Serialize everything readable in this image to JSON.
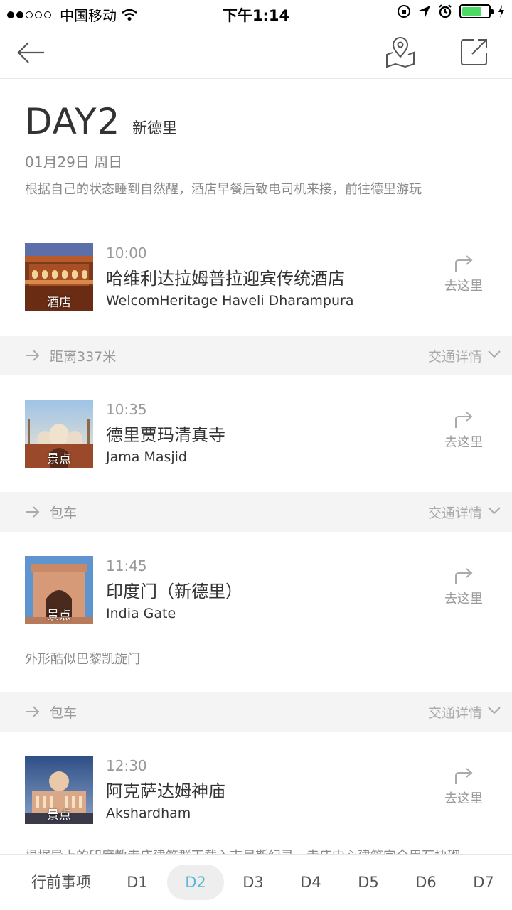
{
  "status": {
    "carrier": "中国移动",
    "time": "下午1:14",
    "battery_level": 0.75
  },
  "nav": {
    "back_icon": "arrow-left-icon",
    "map_icon": "map-pin-icon",
    "share_icon": "share-icon"
  },
  "day": {
    "title": "DAY2",
    "city": "新德里",
    "date": "01月29日 周日",
    "desc": "根据自己的状态睡到自然醒，酒店早餐后致电司机来接，前往德里游玩"
  },
  "go_label": "去这里",
  "pois": [
    {
      "time": "10:00",
      "name": "哈维利达拉姆普拉迎宾传统酒店",
      "en": "WelcomHeritage Haveli Dharampura",
      "tag": "酒店",
      "note": ""
    },
    {
      "time": "10:35",
      "name": "德里贾玛清真寺",
      "en": "Jama Masjid",
      "tag": "景点",
      "note": ""
    },
    {
      "time": "11:45",
      "name": "印度门（新德里）",
      "en": "India Gate",
      "tag": "景点",
      "note": "外形酷似巴黎凯旋门"
    },
    {
      "time": "12:30",
      "name": "阿克萨达姆神庙",
      "en": "Akshardham",
      "tag": "景点",
      "note": ""
    }
  ],
  "transports": [
    {
      "label": "距离337米",
      "detail": "交通详情"
    },
    {
      "label": "包车",
      "detail": "交通详情"
    },
    {
      "label": "包车",
      "detail": "交通详情"
    }
  ],
  "cut_text": "根据导上的印度教寺庙建筑群下载入吉尼斯纪录，寺庙中心建筑完全用石块砌",
  "tabs": [
    "行前事项",
    "D1",
    "D2",
    "D3",
    "D4",
    "D5",
    "D6",
    "D7"
  ],
  "active_tab": "D2"
}
